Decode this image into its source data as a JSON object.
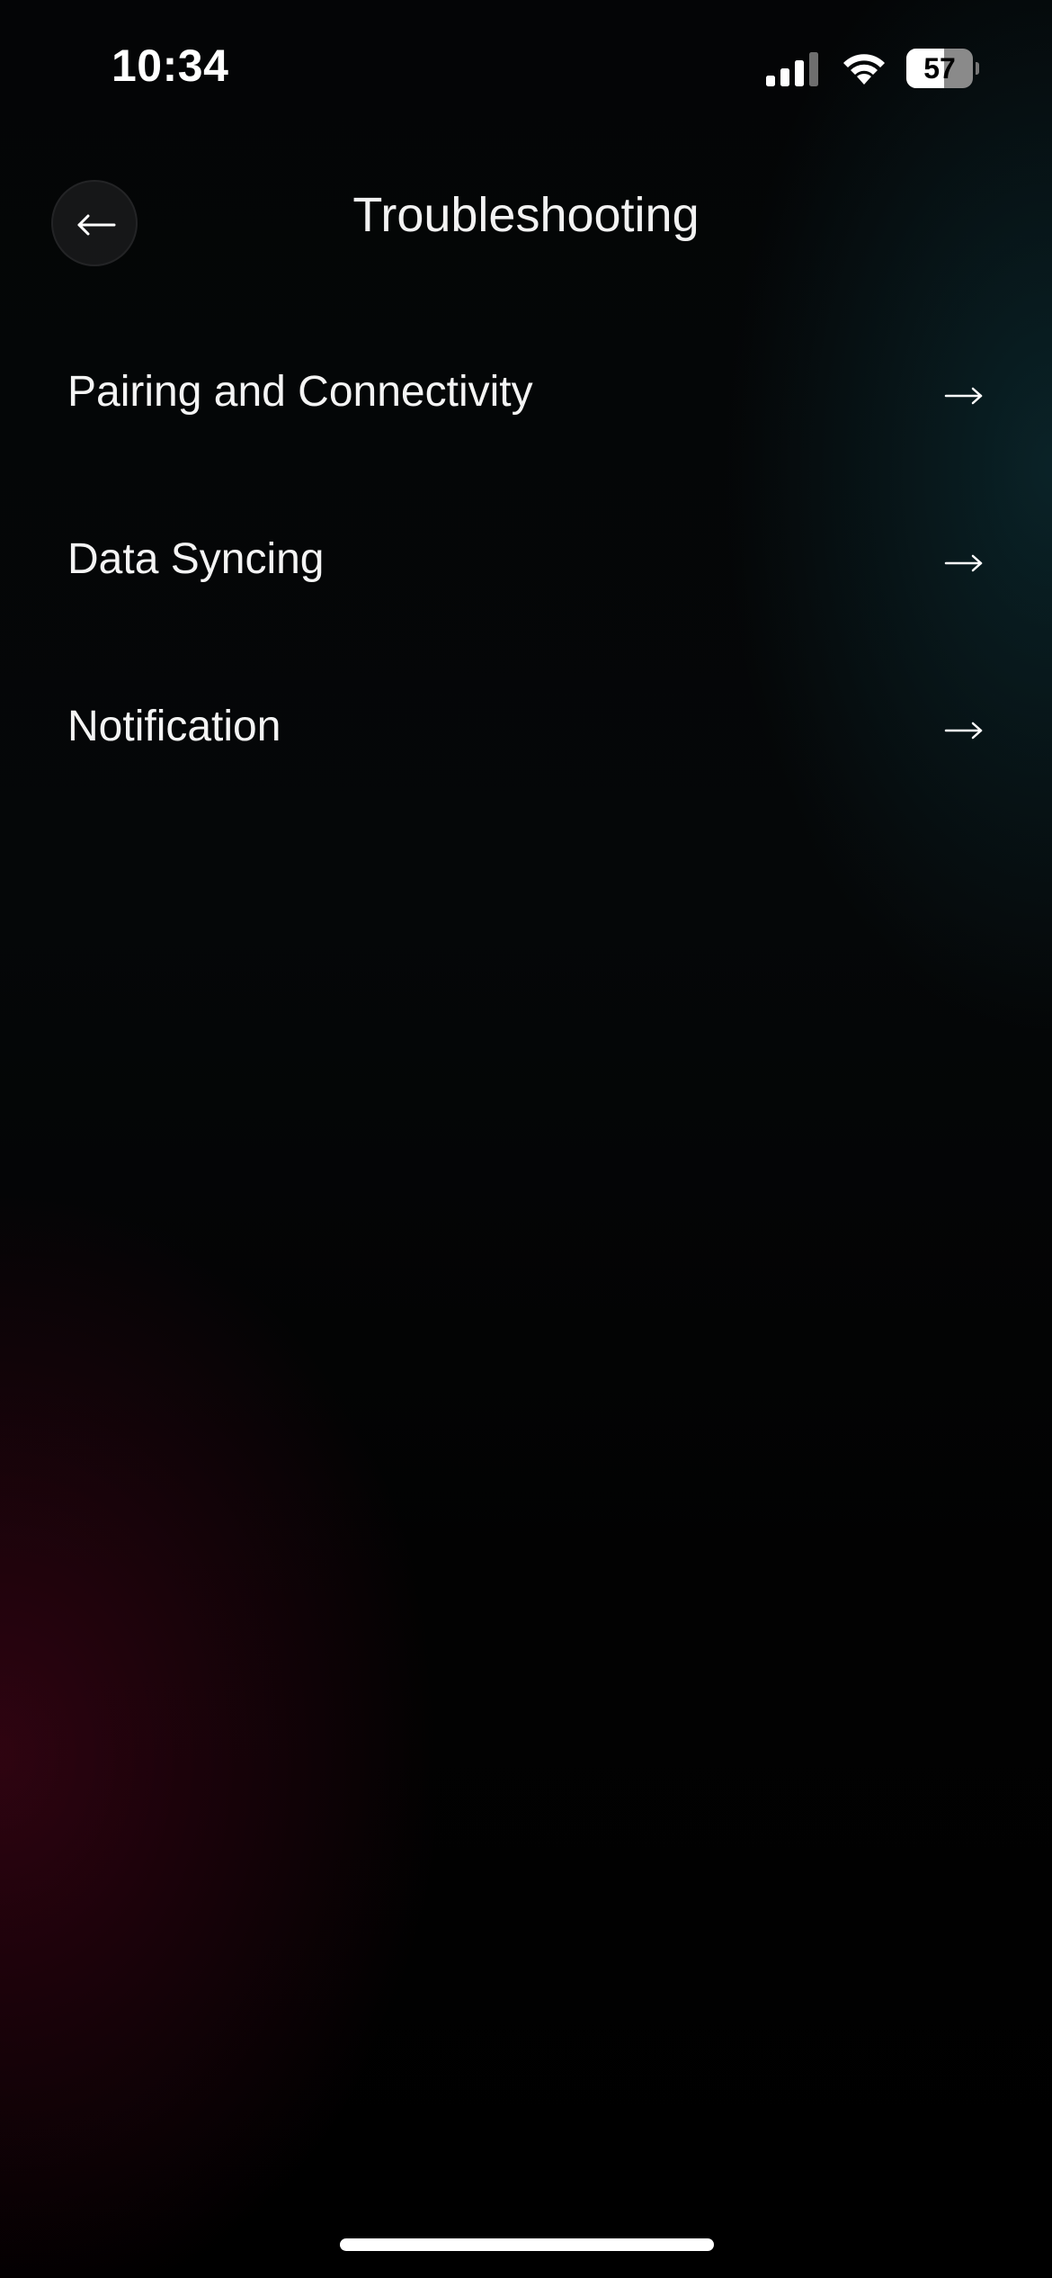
{
  "status_bar": {
    "time": "10:34",
    "signal_icon": "cellular-signal-icon",
    "wifi_icon": "wifi-icon",
    "battery_level": "57",
    "battery_fraction": 0.57
  },
  "header": {
    "back_icon": "arrow-left-icon",
    "title": "Troubleshooting"
  },
  "menu": {
    "items": [
      {
        "label": "Pairing and Connectivity",
        "icon": "arrow-right-icon"
      },
      {
        "label": "Data Syncing",
        "icon": "arrow-right-icon"
      },
      {
        "label": "Notification",
        "icon": "arrow-right-icon"
      }
    ]
  },
  "colors": {
    "background": "#000000",
    "text": "#ffffff",
    "teal_glow": "#0e3a42",
    "crimson_glow": "#3e0416"
  }
}
